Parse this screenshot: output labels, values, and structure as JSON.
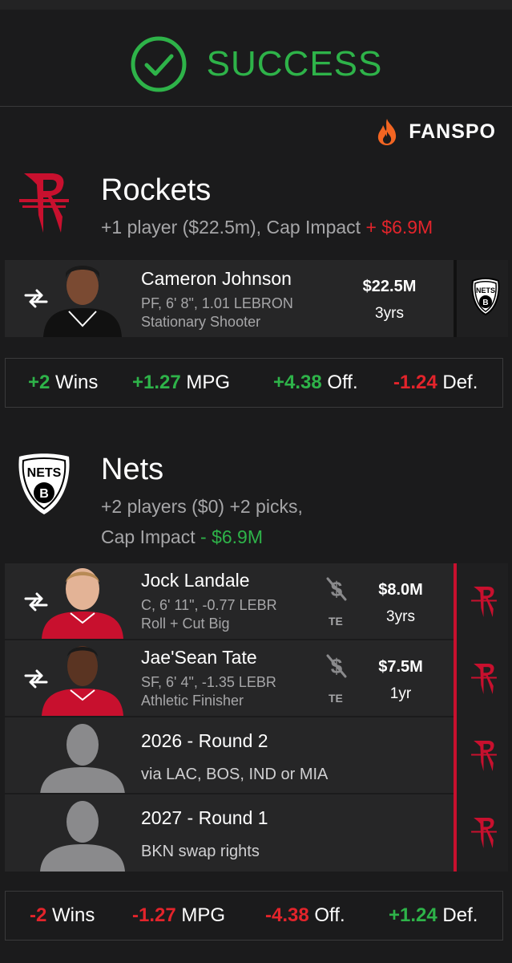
{
  "header": {
    "status": "SUCCESS",
    "brand": "FANSPO"
  },
  "colors": {
    "success": "#2eb349",
    "rockets_red": "#c8102e",
    "positive": "#2eb349",
    "negative": "#e3242b"
  },
  "teams": [
    {
      "name": "Rockets",
      "summary": "+1 player ($22.5m), Cap Impact",
      "cap_sign": "+",
      "cap_value": "$6.9M",
      "incoming": [
        {
          "name": "Cameron Johnson",
          "info": "PF, 6' 8\", 1.01 LEBRON",
          "role": "Stationary Shooter",
          "salary": "$22.5M",
          "years": "3yrs",
          "from_logo": "nets-logo"
        }
      ],
      "stats": [
        {
          "value": "+2",
          "label": "Wins"
        },
        {
          "value": "+1.27",
          "label": "MPG"
        },
        {
          "value": "+4.38",
          "label": "Off."
        },
        {
          "value": "-1.24",
          "label": "Def."
        }
      ]
    },
    {
      "name": "Nets",
      "summary_line1": "+2 players ($0) +2 picks,",
      "summary_line2": "Cap Impact",
      "cap_sign": "-",
      "cap_value": "$6.9M",
      "incoming": [
        {
          "name": "Jock Landale",
          "info": "C, 6' 11\", -0.77 LEBR",
          "role": "Roll + Cut Big",
          "salary": "$8.0M",
          "years": "3yrs",
          "te": "TE",
          "from_logo": "rockets-logo"
        },
        {
          "name": "Jae'Sean Tate",
          "info": "SF, 6' 4\", -1.35 LEBR",
          "role": "Athletic Finisher",
          "salary": "$7.5M",
          "years": "1yr",
          "te": "TE",
          "from_logo": "rockets-logo"
        }
      ],
      "picks": [
        {
          "title": "2026 - Round 2",
          "detail": "via LAC, BOS, IND or MIA",
          "from_logo": "rockets-logo"
        },
        {
          "title": "2027 - Round 1",
          "detail": "BKN swap rights",
          "from_logo": "rockets-logo"
        }
      ],
      "stats": [
        {
          "value": "-2",
          "label": "Wins"
        },
        {
          "value": "-1.27",
          "label": "MPG"
        },
        {
          "value": "-4.38",
          "label": "Off."
        },
        {
          "value": "+1.24",
          "label": "Def."
        }
      ]
    }
  ]
}
